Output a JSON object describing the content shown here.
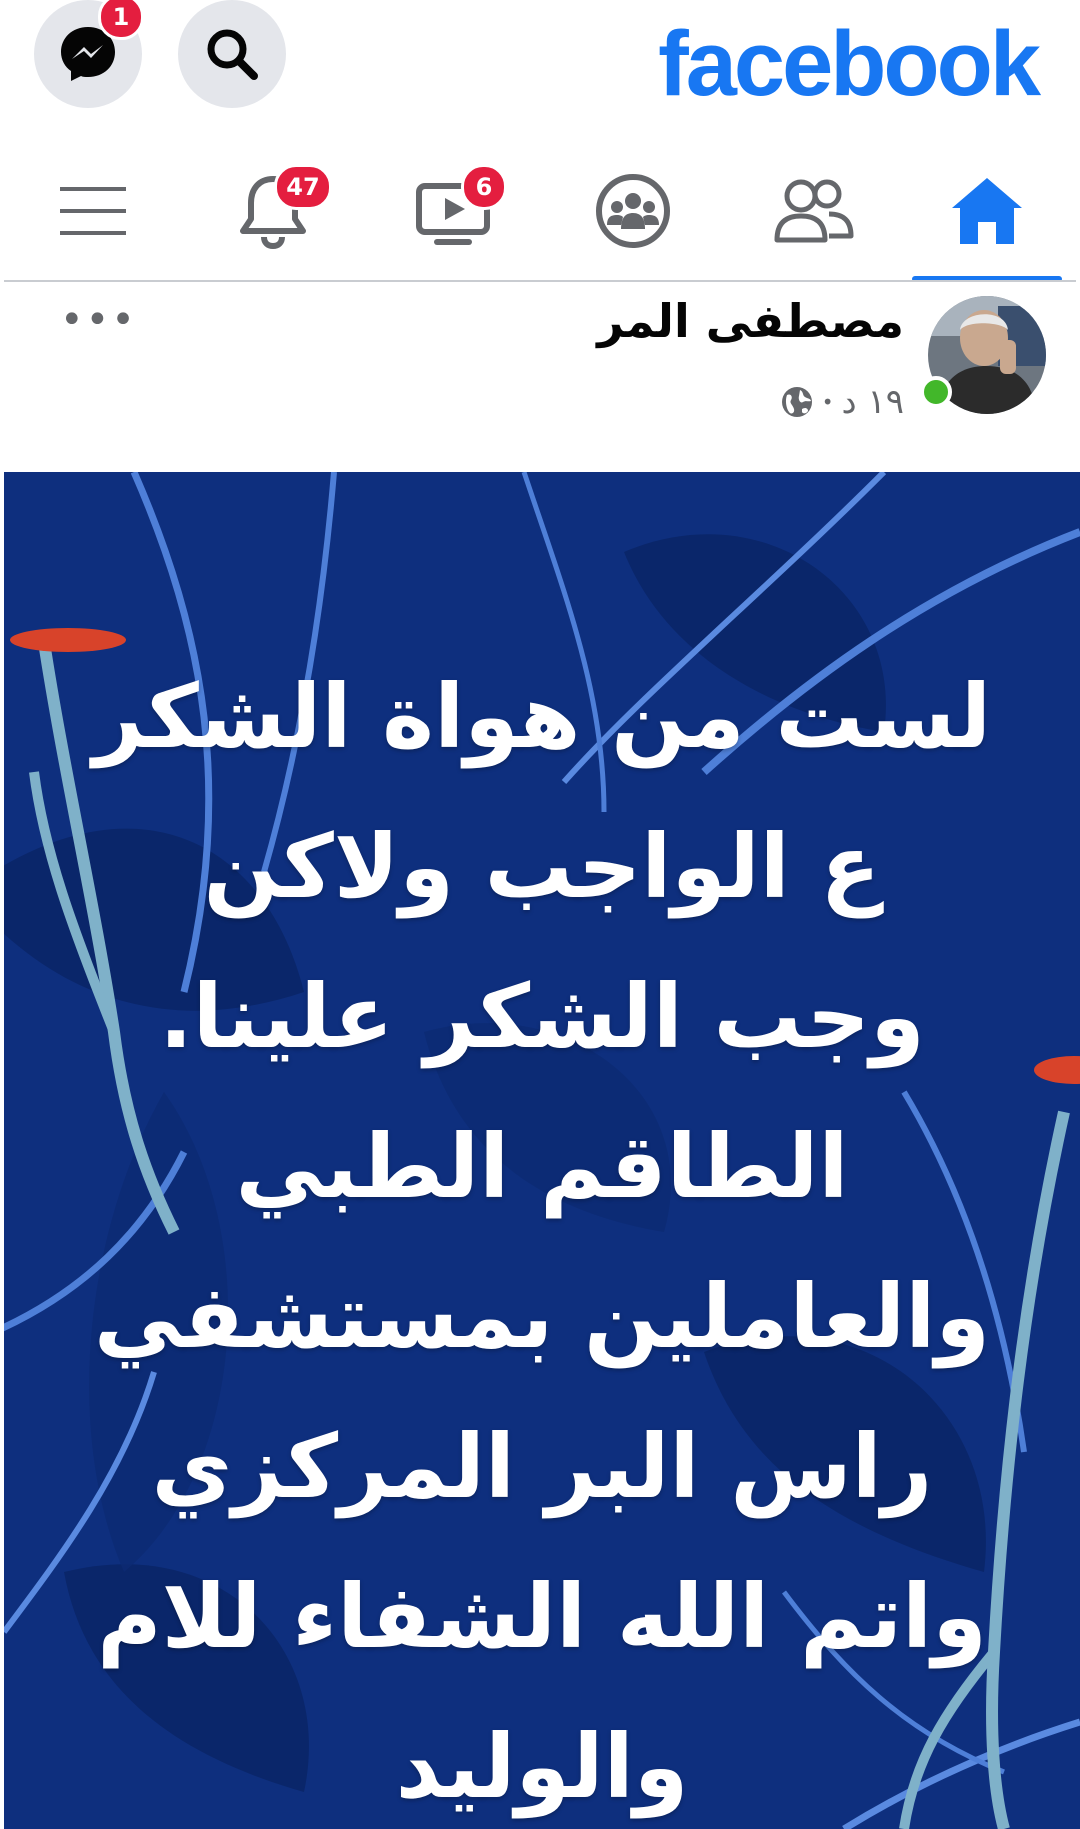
{
  "topbar": {
    "logo": "facebook",
    "messenger_badge": "1",
    "icons": [
      "messenger-icon",
      "search-icon"
    ]
  },
  "nav": {
    "items": [
      {
        "name": "home",
        "icon": "home-icon",
        "active": true
      },
      {
        "name": "friends",
        "icon": "friends-icon"
      },
      {
        "name": "groups",
        "icon": "groups-icon"
      },
      {
        "name": "watch",
        "icon": "video-icon",
        "badge": "6"
      },
      {
        "name": "notifications",
        "icon": "bell-icon",
        "badge": "47"
      },
      {
        "name": "menu",
        "icon": "hamburger-icon"
      }
    ]
  },
  "post": {
    "author": "مصطفى المر",
    "time": "١٩ د",
    "separator": "•",
    "privacy_icon": "globe-icon",
    "more": "•••",
    "text_lines": [
      "لست من هواة الشكر",
      "ع الواجب ولاكن",
      "وجب الشكر علينا.",
      "الطاقم الطبي",
      "والعاملين  بمستشفي",
      "راس البر المركزي",
      "واتم الله الشفاء للام",
      "والوليد"
    ],
    "background": "dark-blue-leaves"
  },
  "colors": {
    "brand": "#1877f2",
    "badge": "#e41e3f",
    "online": "#42b72a",
    "post_bg": "#0e2f7e"
  }
}
